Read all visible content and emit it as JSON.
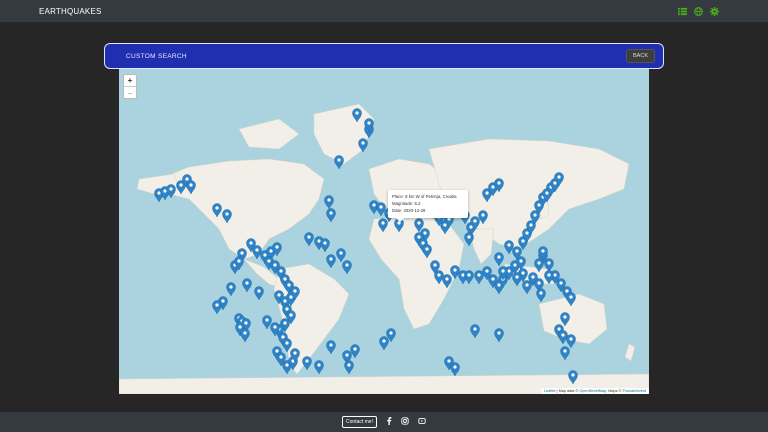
{
  "navbar": {
    "brand": "EARTHQUAKES",
    "icons": [
      "list-icon",
      "globe-icon",
      "gear-icon"
    ],
    "icon_color": "#4caf1a"
  },
  "panel": {
    "title": "CUSTOM SEARCH",
    "back_label": "BACK",
    "header_color": "#1f2fb0"
  },
  "map": {
    "zoom_in": "+",
    "zoom_out": "−",
    "popup": {
      "place": "Place: 8 km W of Petrinja, Croatia",
      "magnitude": "Magnitude: 5.2",
      "date": "Date: 2020-12-28"
    },
    "attribution": {
      "leaflet": "Leaflet",
      "map_data": " | Map data © ",
      "osm": "OpenStreetMap",
      "imagery": ", Maps © ",
      "thunderforest": "Thunderforest"
    },
    "marker_color": "#2f84c8"
  },
  "footer": {
    "contact_label": "Contact me!",
    "icons": [
      "facebook-icon",
      "instagram-icon",
      "youtube-icon"
    ]
  }
}
